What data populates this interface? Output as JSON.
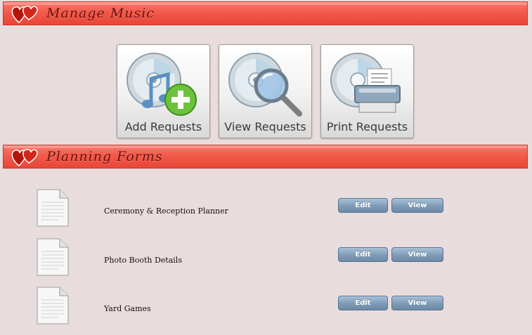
{
  "sections": {
    "music_title": "Manage Music",
    "forms_title": "Planning Forms"
  },
  "music_actions": [
    {
      "label": "Add Requests",
      "icon": "cd-add-icon"
    },
    {
      "label": "View Requests",
      "icon": "cd-search-icon"
    },
    {
      "label": "Print Requests",
      "icon": "cd-print-icon"
    }
  ],
  "forms": [
    {
      "name": "Ceremony & Reception Planner",
      "edit_label": "Edit",
      "view_label": "View"
    },
    {
      "name": "Photo Booth Details",
      "edit_label": "Edit",
      "view_label": "View"
    },
    {
      "name": "Yard Games",
      "edit_label": "Edit",
      "view_label": "View"
    }
  ],
  "colors": {
    "background": "#e9dcdc",
    "header": "#f25a4b",
    "header_text": "#6b0f0a",
    "button": "#7e9ab5"
  }
}
